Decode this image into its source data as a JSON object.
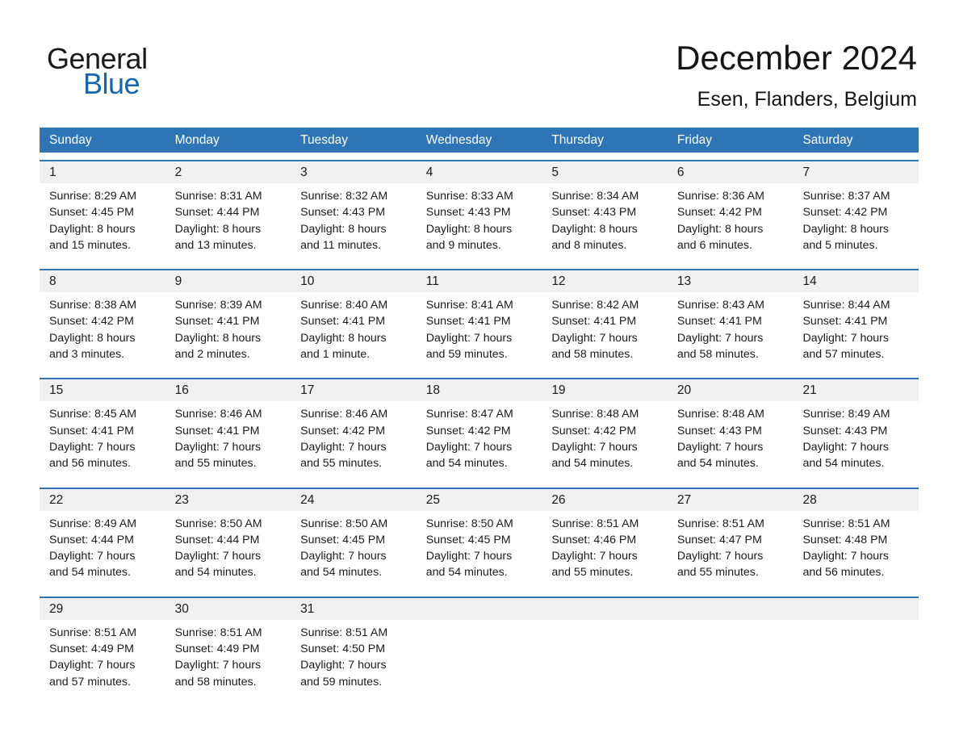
{
  "brand": {
    "name_part1": "General",
    "name_part2": "Blue",
    "triangle_icon": "triangle-icon",
    "accent_color": "#1565b0"
  },
  "header": {
    "month_title": "December 2024",
    "location": "Esen, Flanders, Belgium"
  },
  "calendar": {
    "header_bg": "#2e75b6",
    "weekdays": [
      "Sunday",
      "Monday",
      "Tuesday",
      "Wednesday",
      "Thursday",
      "Friday",
      "Saturday"
    ],
    "weeks": [
      {
        "days": [
          {
            "number": "1",
            "sunrise": "Sunrise: 8:29 AM",
            "sunset": "Sunset: 4:45 PM",
            "daylight_line1": "Daylight: 8 hours",
            "daylight_line2": "and 15 minutes."
          },
          {
            "number": "2",
            "sunrise": "Sunrise: 8:31 AM",
            "sunset": "Sunset: 4:44 PM",
            "daylight_line1": "Daylight: 8 hours",
            "daylight_line2": "and 13 minutes."
          },
          {
            "number": "3",
            "sunrise": "Sunrise: 8:32 AM",
            "sunset": "Sunset: 4:43 PM",
            "daylight_line1": "Daylight: 8 hours",
            "daylight_line2": "and 11 minutes."
          },
          {
            "number": "4",
            "sunrise": "Sunrise: 8:33 AM",
            "sunset": "Sunset: 4:43 PM",
            "daylight_line1": "Daylight: 8 hours",
            "daylight_line2": "and 9 minutes."
          },
          {
            "number": "5",
            "sunrise": "Sunrise: 8:34 AM",
            "sunset": "Sunset: 4:43 PM",
            "daylight_line1": "Daylight: 8 hours",
            "daylight_line2": "and 8 minutes."
          },
          {
            "number": "6",
            "sunrise": "Sunrise: 8:36 AM",
            "sunset": "Sunset: 4:42 PM",
            "daylight_line1": "Daylight: 8 hours",
            "daylight_line2": "and 6 minutes."
          },
          {
            "number": "7",
            "sunrise": "Sunrise: 8:37 AM",
            "sunset": "Sunset: 4:42 PM",
            "daylight_line1": "Daylight: 8 hours",
            "daylight_line2": "and 5 minutes."
          }
        ]
      },
      {
        "days": [
          {
            "number": "8",
            "sunrise": "Sunrise: 8:38 AM",
            "sunset": "Sunset: 4:42 PM",
            "daylight_line1": "Daylight: 8 hours",
            "daylight_line2": "and 3 minutes."
          },
          {
            "number": "9",
            "sunrise": "Sunrise: 8:39 AM",
            "sunset": "Sunset: 4:41 PM",
            "daylight_line1": "Daylight: 8 hours",
            "daylight_line2": "and 2 minutes."
          },
          {
            "number": "10",
            "sunrise": "Sunrise: 8:40 AM",
            "sunset": "Sunset: 4:41 PM",
            "daylight_line1": "Daylight: 8 hours",
            "daylight_line2": "and 1 minute."
          },
          {
            "number": "11",
            "sunrise": "Sunrise: 8:41 AM",
            "sunset": "Sunset: 4:41 PM",
            "daylight_line1": "Daylight: 7 hours",
            "daylight_line2": "and 59 minutes."
          },
          {
            "number": "12",
            "sunrise": "Sunrise: 8:42 AM",
            "sunset": "Sunset: 4:41 PM",
            "daylight_line1": "Daylight: 7 hours",
            "daylight_line2": "and 58 minutes."
          },
          {
            "number": "13",
            "sunrise": "Sunrise: 8:43 AM",
            "sunset": "Sunset: 4:41 PM",
            "daylight_line1": "Daylight: 7 hours",
            "daylight_line2": "and 58 minutes."
          },
          {
            "number": "14",
            "sunrise": "Sunrise: 8:44 AM",
            "sunset": "Sunset: 4:41 PM",
            "daylight_line1": "Daylight: 7 hours",
            "daylight_line2": "and 57 minutes."
          }
        ]
      },
      {
        "days": [
          {
            "number": "15",
            "sunrise": "Sunrise: 8:45 AM",
            "sunset": "Sunset: 4:41 PM",
            "daylight_line1": "Daylight: 7 hours",
            "daylight_line2": "and 56 minutes."
          },
          {
            "number": "16",
            "sunrise": "Sunrise: 8:46 AM",
            "sunset": "Sunset: 4:41 PM",
            "daylight_line1": "Daylight: 7 hours",
            "daylight_line2": "and 55 minutes."
          },
          {
            "number": "17",
            "sunrise": "Sunrise: 8:46 AM",
            "sunset": "Sunset: 4:42 PM",
            "daylight_line1": "Daylight: 7 hours",
            "daylight_line2": "and 55 minutes."
          },
          {
            "number": "18",
            "sunrise": "Sunrise: 8:47 AM",
            "sunset": "Sunset: 4:42 PM",
            "daylight_line1": "Daylight: 7 hours",
            "daylight_line2": "and 54 minutes."
          },
          {
            "number": "19",
            "sunrise": "Sunrise: 8:48 AM",
            "sunset": "Sunset: 4:42 PM",
            "daylight_line1": "Daylight: 7 hours",
            "daylight_line2": "and 54 minutes."
          },
          {
            "number": "20",
            "sunrise": "Sunrise: 8:48 AM",
            "sunset": "Sunset: 4:43 PM",
            "daylight_line1": "Daylight: 7 hours",
            "daylight_line2": "and 54 minutes."
          },
          {
            "number": "21",
            "sunrise": "Sunrise: 8:49 AM",
            "sunset": "Sunset: 4:43 PM",
            "daylight_line1": "Daylight: 7 hours",
            "daylight_line2": "and 54 minutes."
          }
        ]
      },
      {
        "days": [
          {
            "number": "22",
            "sunrise": "Sunrise: 8:49 AM",
            "sunset": "Sunset: 4:44 PM",
            "daylight_line1": "Daylight: 7 hours",
            "daylight_line2": "and 54 minutes."
          },
          {
            "number": "23",
            "sunrise": "Sunrise: 8:50 AM",
            "sunset": "Sunset: 4:44 PM",
            "daylight_line1": "Daylight: 7 hours",
            "daylight_line2": "and 54 minutes."
          },
          {
            "number": "24",
            "sunrise": "Sunrise: 8:50 AM",
            "sunset": "Sunset: 4:45 PM",
            "daylight_line1": "Daylight: 7 hours",
            "daylight_line2": "and 54 minutes."
          },
          {
            "number": "25",
            "sunrise": "Sunrise: 8:50 AM",
            "sunset": "Sunset: 4:45 PM",
            "daylight_line1": "Daylight: 7 hours",
            "daylight_line2": "and 54 minutes."
          },
          {
            "number": "26",
            "sunrise": "Sunrise: 8:51 AM",
            "sunset": "Sunset: 4:46 PM",
            "daylight_line1": "Daylight: 7 hours",
            "daylight_line2": "and 55 minutes."
          },
          {
            "number": "27",
            "sunrise": "Sunrise: 8:51 AM",
            "sunset": "Sunset: 4:47 PM",
            "daylight_line1": "Daylight: 7 hours",
            "daylight_line2": "and 55 minutes."
          },
          {
            "number": "28",
            "sunrise": "Sunrise: 8:51 AM",
            "sunset": "Sunset: 4:48 PM",
            "daylight_line1": "Daylight: 7 hours",
            "daylight_line2": "and 56 minutes."
          }
        ]
      },
      {
        "days": [
          {
            "number": "29",
            "sunrise": "Sunrise: 8:51 AM",
            "sunset": "Sunset: 4:49 PM",
            "daylight_line1": "Daylight: 7 hours",
            "daylight_line2": "and 57 minutes."
          },
          {
            "number": "30",
            "sunrise": "Sunrise: 8:51 AM",
            "sunset": "Sunset: 4:49 PM",
            "daylight_line1": "Daylight: 7 hours",
            "daylight_line2": "and 58 minutes."
          },
          {
            "number": "31",
            "sunrise": "Sunrise: 8:51 AM",
            "sunset": "Sunset: 4:50 PM",
            "daylight_line1": "Daylight: 7 hours",
            "daylight_line2": "and 59 minutes."
          },
          {
            "number": "",
            "sunrise": "",
            "sunset": "",
            "daylight_line1": "",
            "daylight_line2": ""
          },
          {
            "number": "",
            "sunrise": "",
            "sunset": "",
            "daylight_line1": "",
            "daylight_line2": ""
          },
          {
            "number": "",
            "sunrise": "",
            "sunset": "",
            "daylight_line1": "",
            "daylight_line2": ""
          },
          {
            "number": "",
            "sunrise": "",
            "sunset": "",
            "daylight_line1": "",
            "daylight_line2": ""
          }
        ]
      }
    ]
  }
}
